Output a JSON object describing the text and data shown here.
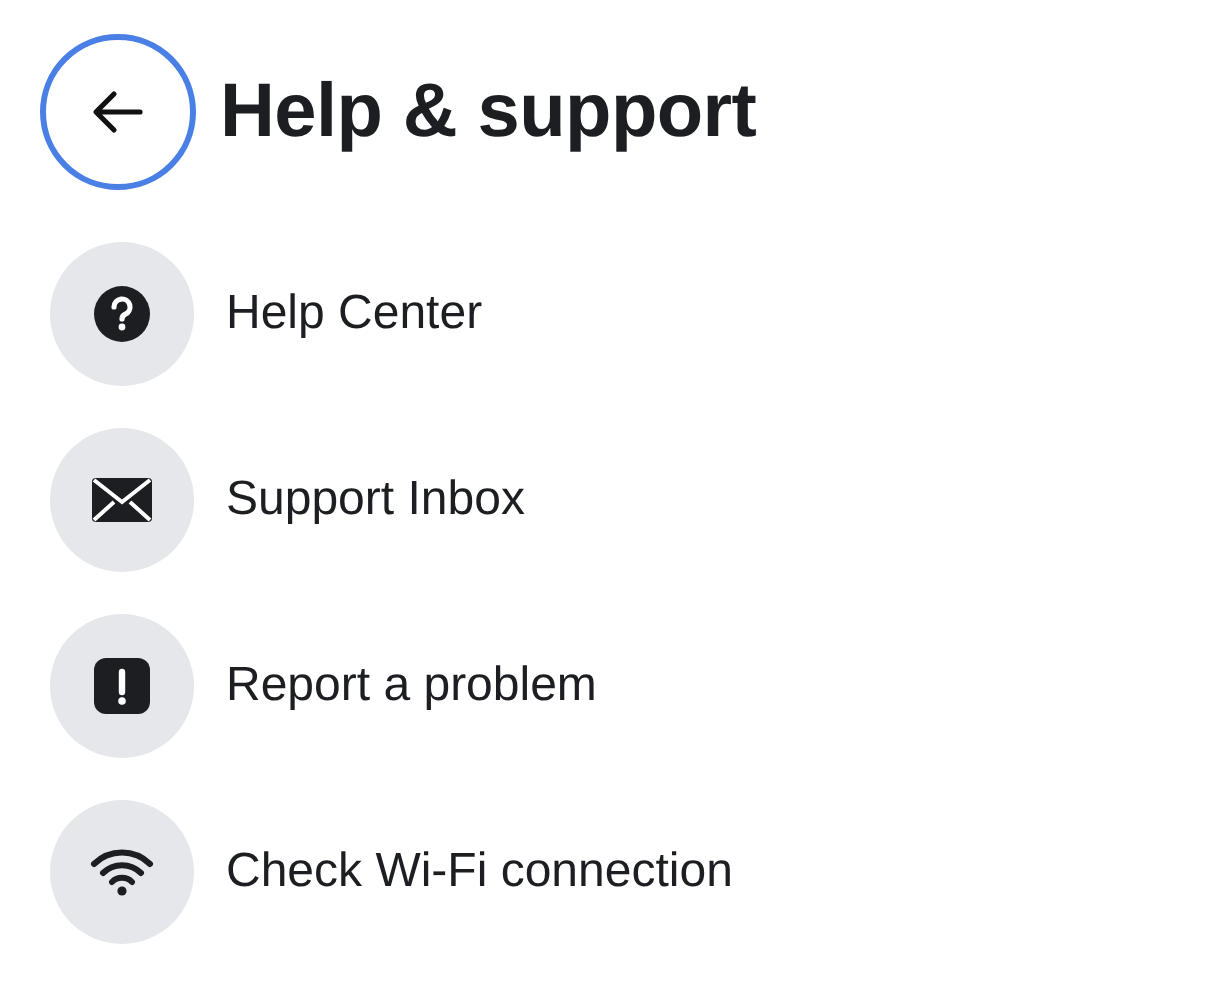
{
  "header": {
    "back_button": {
      "focused": true
    },
    "title": "Help & support"
  },
  "items": [
    {
      "label": "Help Center"
    },
    {
      "label": "Support Inbox"
    },
    {
      "label": "Report a problem"
    },
    {
      "label": "Check Wi-Fi connection"
    }
  ]
}
